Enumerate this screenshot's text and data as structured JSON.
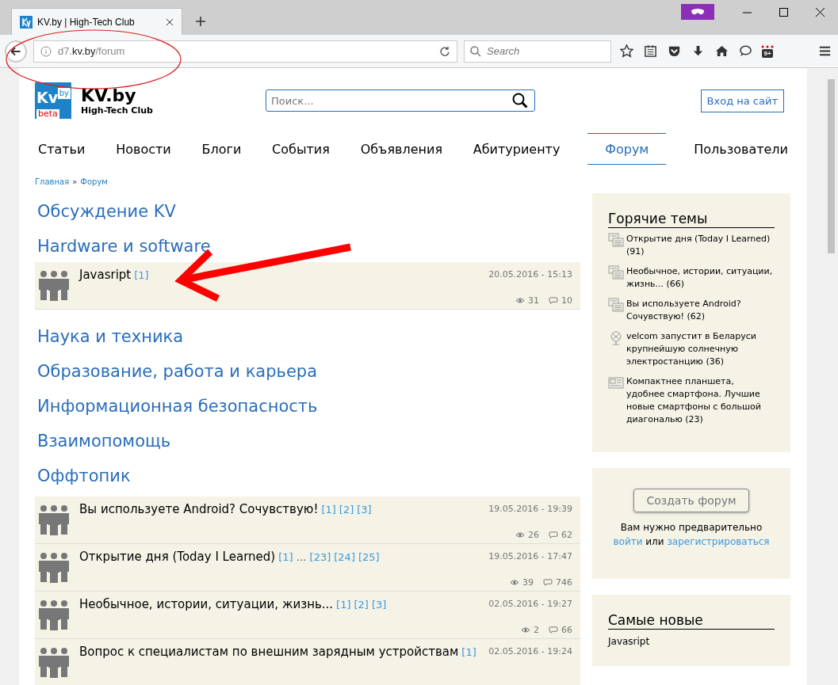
{
  "browser": {
    "tab_title": "KV.by | High-Tech Club",
    "url_prefix": "d7.",
    "url_domain": "kv.by",
    "url_path": "/forum",
    "search_placeholder": "Search",
    "badge": "9+"
  },
  "header": {
    "logo": {
      "mark": "Kv",
      "corner": "by",
      "tag": "beta"
    },
    "site_name": "KV.by",
    "tagline": "High-Tech Club",
    "search_placeholder": "Поиск...",
    "login_button": "Вход на сайт"
  },
  "nav": [
    {
      "label": "Статьи",
      "selected": false
    },
    {
      "label": "Новости",
      "selected": false
    },
    {
      "label": "Блоги",
      "selected": false
    },
    {
      "label": "События",
      "selected": false
    },
    {
      "label": "Объявления",
      "selected": false
    },
    {
      "label": "Абитуриенту",
      "selected": false
    },
    {
      "label": "Форум",
      "selected": true
    },
    {
      "label": "Пользователи",
      "selected": false
    }
  ],
  "breadcrumb": {
    "items": [
      "Главная",
      "Форум"
    ],
    "separator": "»"
  },
  "sections": [
    {
      "title": "Обсуждение KV"
    },
    {
      "title": "Hardware и software",
      "topics": [
        {
          "title": "Javasript",
          "pages": [
            {
              "kind": "link",
              "label": "[1]"
            }
          ],
          "date": "20.05.2016 - 15:13",
          "views": "31",
          "comments": "10"
        }
      ]
    },
    {
      "title": "Наука и техника"
    },
    {
      "title": "Образование, работа и карьера"
    },
    {
      "title": "Информационная безопасность"
    },
    {
      "title": "Взаимопомощь"
    },
    {
      "title": "Оффтопик",
      "topics": [
        {
          "title": "Вы используете Android? Сочувствую!",
          "pages": [
            {
              "kind": "link",
              "label": "[1]"
            },
            {
              "kind": "link",
              "label": "[2]"
            },
            {
              "kind": "link",
              "label": "[3]"
            }
          ],
          "date": "19.05.2016 - 19:39",
          "views": "26",
          "comments": "62"
        },
        {
          "title": "Открытие дня (Today I Learned)",
          "pages": [
            {
              "kind": "link",
              "label": "[1]"
            },
            {
              "kind": "gap",
              "label": "…"
            },
            {
              "kind": "link",
              "label": "[23]"
            },
            {
              "kind": "link",
              "label": "[24]"
            },
            {
              "kind": "link",
              "label": "[25]"
            }
          ],
          "date": "19.05.2016 - 17:47",
          "views": "39",
          "comments": "746"
        },
        {
          "title": "Необычное, истории, ситуации, жизнь...",
          "pages": [
            {
              "kind": "link",
              "label": "[1]"
            },
            {
              "kind": "link",
              "label": "[2]"
            },
            {
              "kind": "link",
              "label": "[3]"
            }
          ],
          "date": "02.05.2016 - 19:27",
          "views": "2",
          "comments": "66"
        },
        {
          "title": "Вопрос к специалистам по внешним зарядным устройствам",
          "pages": [
            {
              "kind": "link",
              "label": "[1]"
            }
          ],
          "date": "02.05.2016 - 19:24"
        }
      ]
    }
  ],
  "hot_topics": {
    "title": "Горячие темы",
    "items": [
      {
        "kind": "forum",
        "text": "Открытие дня (Today I Learned) (91)"
      },
      {
        "kind": "forum",
        "text": "Необычное, истории, ситуации, жизнь... (66)"
      },
      {
        "kind": "forum",
        "text": "Вы используете Android? Сочувствую! (62)"
      },
      {
        "kind": "news",
        "text": "velcom запустит в Беларуси крупнейшую солнечную электростанцию (36)"
      },
      {
        "kind": "article",
        "text": "Компактнее планшета, удобнее смартфона. Лучшие новые смартфоны с большой диагональю (23)"
      }
    ]
  },
  "create_forum": {
    "button": "Создать форум",
    "note": "Вам нужно предварительно",
    "login_link": "войти",
    "or": "или",
    "register_link": "зарегистрироваться"
  },
  "newest": {
    "title": "Самые новые",
    "items": [
      "Javasript"
    ]
  }
}
